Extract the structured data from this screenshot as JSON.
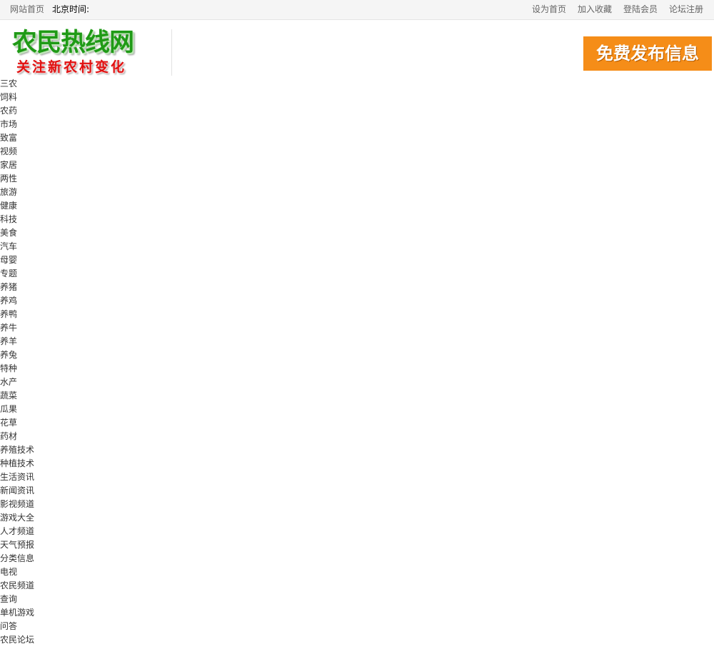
{
  "topbar": {
    "home_link": "网站首页",
    "clock_label": "北京时间:",
    "right_links": [
      "设为首页",
      "加入收藏",
      "登陆会员",
      "论坛注册"
    ]
  },
  "header": {
    "logo_title": "农民热线网",
    "logo_slogan": "关注新农村变化",
    "post_button": "免费发布信息"
  },
  "nav": {
    "items": [
      "三农",
      "饲料",
      "农药",
      "市场",
      "致富",
      "视频",
      "家居",
      "两性",
      "旅游",
      "健康",
      "科技",
      "美食",
      "汽车",
      "母婴",
      "专题",
      "养猪",
      "养鸡",
      "养鸭",
      "养牛",
      "养羊",
      "养兔",
      "特种",
      "水产",
      "蔬菜",
      "瓜果",
      "花草",
      "药材",
      "养殖技术",
      "种植技术",
      "生活资讯",
      "新闻资讯",
      "影视频道",
      "游戏大全",
      "人才频道",
      "天气预报",
      "分类信息",
      "电视",
      "农民频道",
      "查询",
      "单机游戏",
      "问答",
      "农民论坛"
    ]
  },
  "colors": {
    "logo_green": "#1f9a16",
    "slogan_red": "#e01010",
    "button_orange": "#f58d18"
  }
}
